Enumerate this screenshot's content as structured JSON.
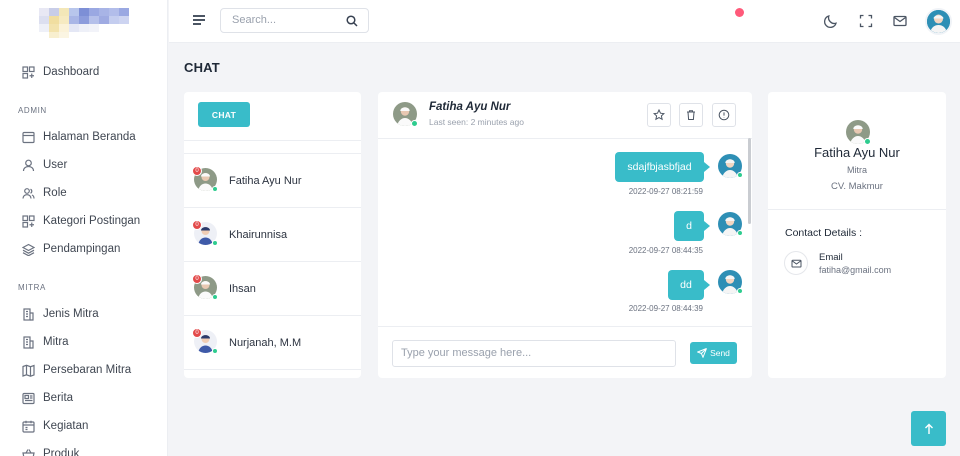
{
  "colors": {
    "accent": "#39bcc9",
    "online": "#2ecc8f",
    "badge": "#e34a4a"
  },
  "sidebar": {
    "dashboard": "Dashboard",
    "section_admin": "ADMIN",
    "admin_items": [
      {
        "label": "Halaman Beranda",
        "icon": "window-icon"
      },
      {
        "label": "User",
        "icon": "user-icon"
      },
      {
        "label": "Role",
        "icon": "users-icon"
      },
      {
        "label": "Kategori Postingan",
        "icon": "grid-icon"
      },
      {
        "label": "Pendampingan",
        "icon": "layers-icon"
      }
    ],
    "section_mitra": "MITRA",
    "mitra_items": [
      {
        "label": "Jenis Mitra",
        "icon": "building-icon"
      },
      {
        "label": "Mitra",
        "icon": "building-icon"
      },
      {
        "label": "Persebaran Mitra",
        "icon": "map-icon"
      },
      {
        "label": "Berita",
        "icon": "newspaper-icon"
      },
      {
        "label": "Kegiatan",
        "icon": "calendar-icon"
      },
      {
        "label": "Produk",
        "icon": "basket-icon"
      }
    ]
  },
  "topbar": {
    "search_placeholder": "Search..."
  },
  "page_title": "CHAT",
  "contacts_panel": {
    "chat_button": "CHAT",
    "contacts": [
      {
        "name": "Fatiha Ayu Nur",
        "unread": "0"
      },
      {
        "name": "Khairunnisa",
        "unread": "0"
      },
      {
        "name": "Ihsan",
        "unread": "0"
      },
      {
        "name": "Nurjanah, M.M",
        "unread": "0"
      }
    ]
  },
  "chat": {
    "name": "Fatiha Ayu Nur",
    "last_seen": "Last seen: 2 minutes ago",
    "messages": [
      {
        "text": "sdajfbjasbfjad",
        "time": "2022-09-27 08:21:59"
      },
      {
        "text": "d",
        "time": "2022-09-27 08:44:35"
      },
      {
        "text": "dd",
        "time": "2022-09-27 08:44:39"
      }
    ],
    "input_placeholder": "Type your message here...",
    "send_label": "Send"
  },
  "profile": {
    "name": "Fatiha Ayu Nur",
    "role": "Mitra",
    "company": "CV. Makmur",
    "contact_heading": "Contact Details :",
    "email_label": "Email",
    "email_value": "fatiha@gmail.com"
  }
}
